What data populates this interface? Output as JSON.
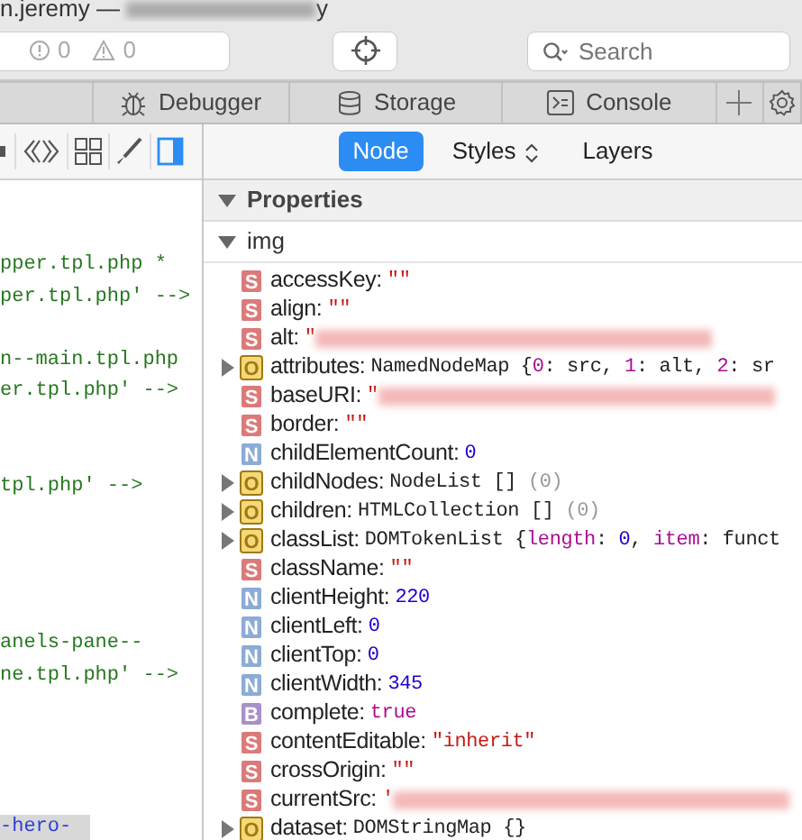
{
  "window": {
    "title_start": "n.jeremy —",
    "title_end": "y"
  },
  "toolbar": {
    "counters": [
      {
        "kind": "error",
        "count": "0"
      },
      {
        "kind": "warning",
        "count": "0"
      }
    ],
    "search": {
      "placeholder": "Search"
    }
  },
  "tabs": [
    {
      "selected": false,
      "kind": "cut"
    },
    {
      "label": "Debugger",
      "selected": false,
      "kind": "debugger"
    },
    {
      "label": "Storage",
      "selected": false,
      "kind": "storage"
    },
    {
      "label": "Console",
      "selected": false,
      "kind": "console"
    }
  ],
  "dom_toolbar": [
    {
      "kind": "cut",
      "selected": false
    },
    {
      "kind": "brackets",
      "selected": false
    },
    {
      "kind": "grid",
      "selected": false
    },
    {
      "kind": "brush",
      "selected": false
    },
    {
      "kind": "sidebar",
      "selected": true
    }
  ],
  "code_lines": [
    {
      "kind": "blank"
    },
    {
      "kind": "blank"
    },
    {
      "kind": "code",
      "text": "pper.tpl.php *"
    },
    {
      "kind": "code",
      "text": "per.tpl.php' -->"
    },
    {
      "kind": "blank"
    },
    {
      "kind": "code",
      "text": "n--main.tpl.php"
    },
    {
      "kind": "code",
      "text": "er.tpl.php' -->"
    },
    {
      "kind": "blank"
    },
    {
      "kind": "blank"
    },
    {
      "kind": "code",
      "text": " tpl.php' -->"
    },
    {
      "kind": "blank"
    },
    {
      "kind": "blank"
    },
    {
      "kind": "blank"
    },
    {
      "kind": "blank"
    },
    {
      "kind": "code",
      "text": "anels-pane--"
    },
    {
      "kind": "code",
      "text": "ne.tpl.php' -->"
    }
  ],
  "breadcrumb": "-hero-",
  "sidebar_tabs": [
    {
      "label": "Node",
      "selected": true,
      "kind": "plain"
    },
    {
      "label": "Styles",
      "selected": false,
      "kind": "chooser"
    },
    {
      "label": "Layers",
      "selected": false,
      "kind": "plain"
    }
  ],
  "section": {
    "title": "Properties",
    "expanded": true
  },
  "object": {
    "name": "img",
    "expanded": true
  },
  "properties": [
    {
      "type": "S",
      "name": "accessKey:",
      "expandable": false,
      "redacted": false,
      "value": [
        {
          "kind": "string",
          "text": "\"\""
        }
      ]
    },
    {
      "type": "S",
      "name": "align:",
      "expandable": false,
      "redacted": false,
      "value": [
        {
          "kind": "string",
          "text": "\"\""
        }
      ]
    },
    {
      "type": "S",
      "name": "alt:",
      "expandable": false,
      "redacted": true,
      "value": [
        {
          "kind": "string",
          "text": "\""
        }
      ]
    },
    {
      "type": "O",
      "name": "attributes:",
      "expandable": true,
      "redacted": false,
      "value": [
        {
          "kind": "plain",
          "text": "NamedNodeMap {"
        },
        {
          "kind": "key",
          "text": "0"
        },
        {
          "kind": "plain",
          "text": ": src, "
        },
        {
          "kind": "key",
          "text": "1"
        },
        {
          "kind": "plain",
          "text": ": alt, "
        },
        {
          "kind": "key",
          "text": "2"
        },
        {
          "kind": "plain",
          "text": ": sr"
        }
      ]
    },
    {
      "type": "S",
      "name": "baseURI:",
      "expandable": false,
      "redacted": true,
      "value": [
        {
          "kind": "string",
          "text": "\""
        }
      ]
    },
    {
      "type": "S",
      "name": "border:",
      "expandable": false,
      "redacted": false,
      "value": [
        {
          "kind": "string",
          "text": "\"\""
        }
      ]
    },
    {
      "type": "N",
      "name": "childElementCount:",
      "expandable": false,
      "redacted": false,
      "value": [
        {
          "kind": "number",
          "text": "0"
        }
      ]
    },
    {
      "type": "O",
      "name": "childNodes:",
      "expandable": true,
      "redacted": false,
      "value": [
        {
          "kind": "plain",
          "text": "NodeList [] "
        },
        {
          "kind": "count",
          "text": "(0)"
        }
      ]
    },
    {
      "type": "O",
      "name": "children:",
      "expandable": true,
      "redacted": false,
      "value": [
        {
          "kind": "plain",
          "text": "HTMLCollection [] "
        },
        {
          "kind": "count",
          "text": "(0)"
        }
      ]
    },
    {
      "type": "O",
      "name": "classList:",
      "expandable": true,
      "redacted": false,
      "value": [
        {
          "kind": "plain",
          "text": "DOMTokenList {"
        },
        {
          "kind": "key",
          "text": "length"
        },
        {
          "kind": "plain",
          "text": ": "
        },
        {
          "kind": "number",
          "text": "0"
        },
        {
          "kind": "plain",
          "text": ", "
        },
        {
          "kind": "key",
          "text": "item"
        },
        {
          "kind": "plain",
          "text": ": funct"
        }
      ]
    },
    {
      "type": "S",
      "name": "className:",
      "expandable": false,
      "redacted": false,
      "value": [
        {
          "kind": "string",
          "text": "\"\""
        }
      ]
    },
    {
      "type": "N",
      "name": "clientHeight:",
      "expandable": false,
      "redacted": false,
      "value": [
        {
          "kind": "number",
          "text": "220"
        }
      ]
    },
    {
      "type": "N",
      "name": "clientLeft:",
      "expandable": false,
      "redacted": false,
      "value": [
        {
          "kind": "number",
          "text": "0"
        }
      ]
    },
    {
      "type": "N",
      "name": "clientTop:",
      "expandable": false,
      "redacted": false,
      "value": [
        {
          "kind": "number",
          "text": "0"
        }
      ]
    },
    {
      "type": "N",
      "name": "clientWidth:",
      "expandable": false,
      "redacted": false,
      "value": [
        {
          "kind": "number",
          "text": "345"
        }
      ]
    },
    {
      "type": "B",
      "name": "complete:",
      "expandable": false,
      "redacted": false,
      "value": [
        {
          "kind": "bool",
          "text": "true"
        }
      ]
    },
    {
      "type": "S",
      "name": "contentEditable:",
      "expandable": false,
      "redacted": false,
      "value": [
        {
          "kind": "string",
          "text": "\"inherit\""
        }
      ]
    },
    {
      "type": "S",
      "name": "crossOrigin:",
      "expandable": false,
      "redacted": false,
      "value": [
        {
          "kind": "string",
          "text": "\"\""
        }
      ]
    },
    {
      "type": "S",
      "name": "currentSrc:",
      "expandable": false,
      "redacted": true,
      "value": [
        {
          "kind": "string",
          "text": "'"
        }
      ]
    },
    {
      "type": "O",
      "name": "dataset:",
      "expandable": true,
      "redacted": false,
      "value": [
        {
          "kind": "plain",
          "text": "DOMStringMap {}"
        }
      ]
    }
  ]
}
